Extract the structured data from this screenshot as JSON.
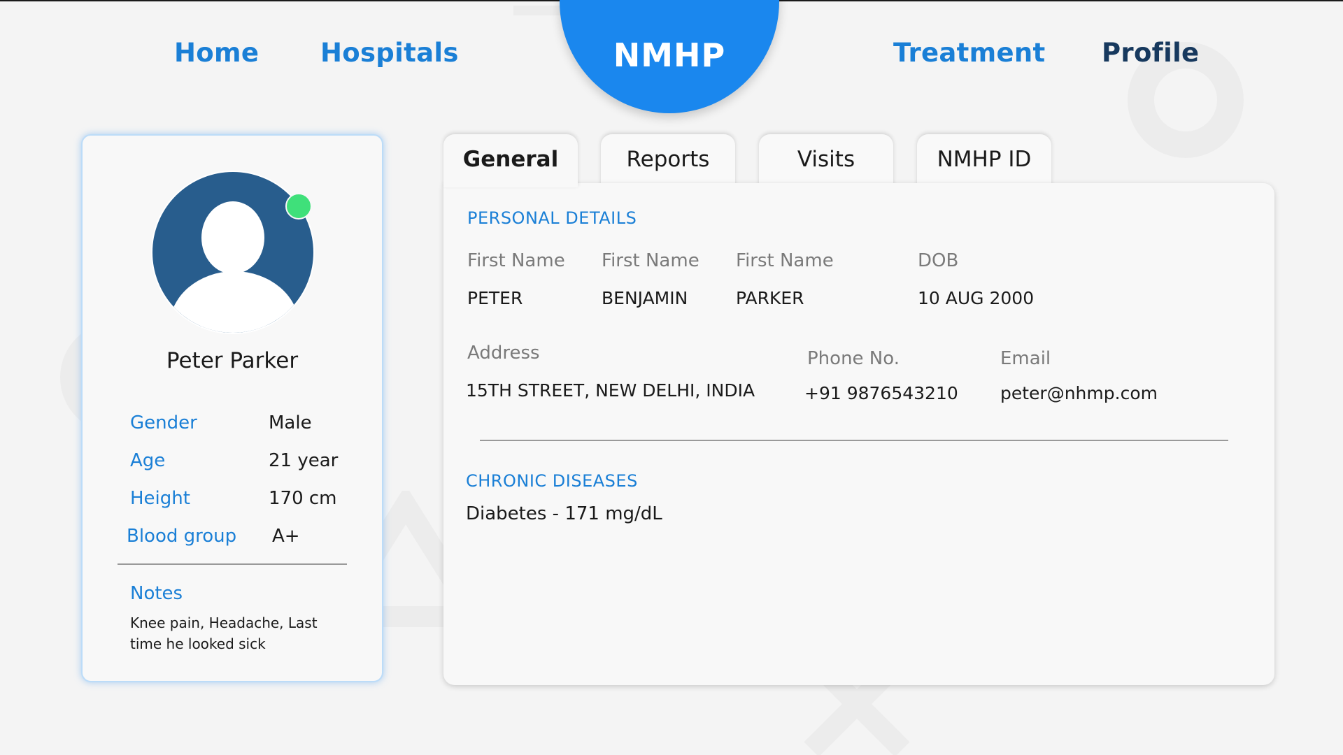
{
  "nav": {
    "home": "Home",
    "hospitals": "Hospitals",
    "brand": "NMHP",
    "treatment": "Treatment",
    "profile": "Profile"
  },
  "profile": {
    "name": "Peter Parker",
    "online_status_color": "#3fe07a",
    "attributes": [
      {
        "label": "Gender",
        "value": "Male"
      },
      {
        "label": "Age",
        "value": "21 year"
      },
      {
        "label": "Height",
        "value": "170 cm"
      },
      {
        "label": "Blood group",
        "value": "A+"
      }
    ],
    "notes_label": "Notes",
    "notes": "Knee pain, Headache, Last time he looked sick"
  },
  "tabs": [
    {
      "label": "General",
      "active": true
    },
    {
      "label": "Reports",
      "active": false
    },
    {
      "label": "Visits",
      "active": false
    },
    {
      "label": "NMHP ID",
      "active": false
    }
  ],
  "personal_details": {
    "title": "PERSONAL DETAILS",
    "first_name_label": "First Name",
    "first_name": "PETER",
    "middle_name_label": "First Name",
    "middle_name": "BENJAMIN",
    "last_name_label": "First Name",
    "last_name": "PARKER",
    "dob_label": "DOB",
    "dob": "10 AUG 2000",
    "address_label": "Address",
    "address": "15TH STREET, NEW DELHI, INDIA",
    "phone_label": "Phone No.",
    "phone": "+91 9876543210",
    "email_label": "Email",
    "email": "peter@nhmp.com"
  },
  "chronic_diseases": {
    "title": "CHRONIC DISEASES",
    "items": [
      "Diabetes - 171 mg/dL"
    ]
  },
  "colors": {
    "accent": "#1a7fd6",
    "brand": "#1a87ee",
    "profile_nav": "#17395e",
    "avatar": "#285d8d"
  }
}
